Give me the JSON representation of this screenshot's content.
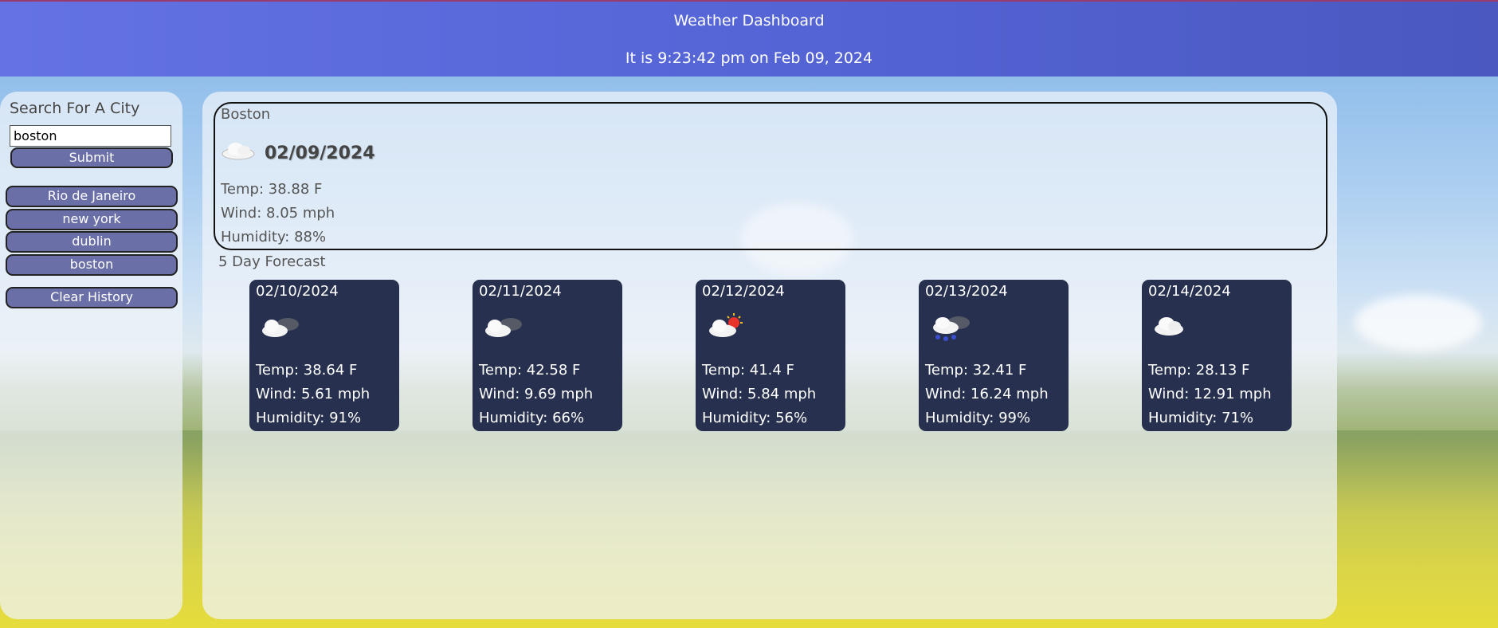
{
  "header": {
    "title": "Weather Dashboard",
    "time_text": "It is 9:23:42 pm on Feb 09, 2024"
  },
  "sidebar": {
    "heading": "Search For A City",
    "search_value": "boston",
    "submit_label": "Submit",
    "history": [
      "Rio de Janeiro",
      "new york",
      "dublin",
      "boston"
    ],
    "clear_label": "Clear History"
  },
  "current": {
    "city": "Boston",
    "date": "02/09/2024",
    "icon": "cloud-icon",
    "temp": "Temp: 38.88 F",
    "wind": "Wind: 8.05 mph",
    "humidity": "Humidity: 88%"
  },
  "forecast": {
    "heading": "5 Day Forecast",
    "days": [
      {
        "date": "02/10/2024",
        "icon": "dark-cloud-icon",
        "temp": "Temp: 38.64 F",
        "wind": "Wind: 5.61 mph",
        "humidity": "Humidity: 91%"
      },
      {
        "date": "02/11/2024",
        "icon": "dark-cloud-icon",
        "temp": "Temp: 42.58 F",
        "wind": "Wind: 9.69 mph",
        "humidity": "Humidity: 66%"
      },
      {
        "date": "02/12/2024",
        "icon": "sun-cloud-icon",
        "temp": "Temp: 41.4 F",
        "wind": "Wind: 5.84 mph",
        "humidity": "Humidity: 56%"
      },
      {
        "date": "02/13/2024",
        "icon": "snow-cloud-icon",
        "temp": "Temp: 32.41 F",
        "wind": "Wind: 16.24 mph",
        "humidity": "Humidity: 99%"
      },
      {
        "date": "02/14/2024",
        "icon": "cloud-icon",
        "temp": "Temp: 28.13 F",
        "wind": "Wind: 12.91 mph",
        "humidity": "Humidity: 71%"
      }
    ]
  }
}
